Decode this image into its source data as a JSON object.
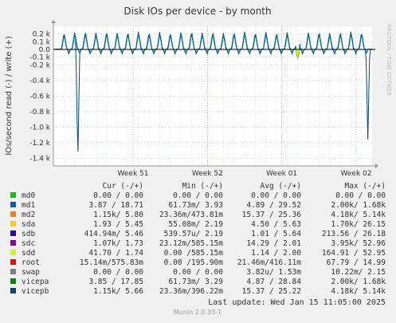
{
  "chart_data": {
    "type": "line",
    "title": "Disk IOs per device - by month",
    "ylabel": "IOs/second read (-) / write (+)",
    "side_label": "RRDTOOL / TOBI OETIKER",
    "ylim": [
      -1500,
      300
    ],
    "y_ticks": [
      {
        "v": 200,
        "label": "0.2 k"
      },
      {
        "v": 100,
        "label": "0.1 k"
      },
      {
        "v": 0,
        "label": "0.0"
      },
      {
        "v": -100,
        "label": "-0.1 k"
      },
      {
        "v": -200,
        "label": "-0.2 k"
      },
      {
        "v": -400,
        "label": "-0.4 k"
      },
      {
        "v": -600,
        "label": "-0.6 k"
      },
      {
        "v": -800,
        "label": "-0.8 k"
      },
      {
        "v": -1000,
        "label": "-1.0 k"
      },
      {
        "v": -1200,
        "label": "-1.2 k"
      },
      {
        "v": -1400,
        "label": "-1.4 k"
      }
    ],
    "x_range_days": [
      0,
      30
    ],
    "x_ticks": [
      {
        "day": 7.5,
        "label": "Week 51"
      },
      {
        "day": 14.5,
        "label": "Week 52"
      },
      {
        "day": 21.5,
        "label": "Week 01"
      },
      {
        "day": 28.5,
        "label": "Week 02"
      }
    ],
    "spike_days": [
      1,
      2,
      3,
      4,
      5,
      6,
      7,
      8,
      9,
      10,
      11,
      12,
      13,
      14,
      15,
      16,
      17,
      18,
      19,
      20,
      21,
      22,
      23,
      24,
      25,
      26,
      27,
      28,
      29
    ],
    "write_spike_peak": 230,
    "read_spike_min": -60,
    "events": [
      {
        "day": 2.3,
        "read": -1480,
        "note": "read burst"
      },
      {
        "day": 23.0,
        "read": -120,
        "note": "sdd dip"
      },
      {
        "day": 29.6,
        "read": -1160,
        "note": "read burst"
      }
    ],
    "legend_header": [
      "Cur (-/+)",
      "Min (-/+)",
      "Avg (-/+)",
      "Max (-/+)"
    ],
    "legend": [
      {
        "name": "md0",
        "color": "#00cc00",
        "cur": "0.00 /  0.00",
        "min": "0.00 /  0.00",
        "avg": "0.00 /  0.00",
        "max": "0.00 /  0.00"
      },
      {
        "name": "md1",
        "color": "#0066b3",
        "cur": "3.87 / 18.71",
        "min": "61.73m/  3.93",
        "avg": "4.89 / 29.52",
        "max": "2.00k/  1.68k"
      },
      {
        "name": "md2",
        "color": "#ff8000",
        "cur": "1.15k/  5.80",
        "min": "23.36m/473.81m",
        "avg": "15.37 / 25.36",
        "max": "4.18k/  5.14k"
      },
      {
        "name": "sda",
        "color": "#ffcc00",
        "cur": "1.93 /  5.45",
        "min": "55.08m/  2.19",
        "avg": "4.50 /  5.63",
        "max": "1.70k/ 26.15"
      },
      {
        "name": "sdb",
        "color": "#330099",
        "cur": "414.94m/  5.46",
        "min": "539.57u/  2.19",
        "avg": "1.01 /  5.64",
        "max": "213.56 / 26.18"
      },
      {
        "name": "sdc",
        "color": "#990099",
        "cur": "1.07k/  1.73",
        "min": "23.12m/585.15m",
        "avg": "14.29 /  2.01",
        "max": "3.95k/ 52.96"
      },
      {
        "name": "sdd",
        "color": "#ccff00",
        "cur": "41.70 /  1.74",
        "min": "0.00 /585.15m",
        "avg": "1.14 /  2.00",
        "max": "164.91 / 52.95"
      },
      {
        "name": "root",
        "color": "#ff0000",
        "cur": "15.14m/575.83m",
        "min": "0.00 /195.90m",
        "avg": "21.46m/416.11m",
        "max": "67.79 / 14.99"
      },
      {
        "name": "swap",
        "color": "#808080",
        "cur": "0.00 /  0.00",
        "min": "0.00 /  0.00",
        "avg": "3.82u/  1.53m",
        "max": "10.22m/  2.15"
      },
      {
        "name": "vicepa",
        "color": "#008f00",
        "cur": "3.85 / 17.85",
        "min": "61.73m/  3.29",
        "avg": "4.87 / 28.84",
        "max": "2.00k/  1.68k"
      },
      {
        "name": "vicepb",
        "color": "#00487d",
        "cur": "1.15k/  5.66",
        "min": "23.36m/396.22m",
        "avg": "15.37 / 25.22",
        "max": "4.18k/  5.14k"
      }
    ],
    "last_update": "Last update:  Wed Jan 15 11:05:00 2025",
    "footer": "Munin 2.0.33-1"
  }
}
